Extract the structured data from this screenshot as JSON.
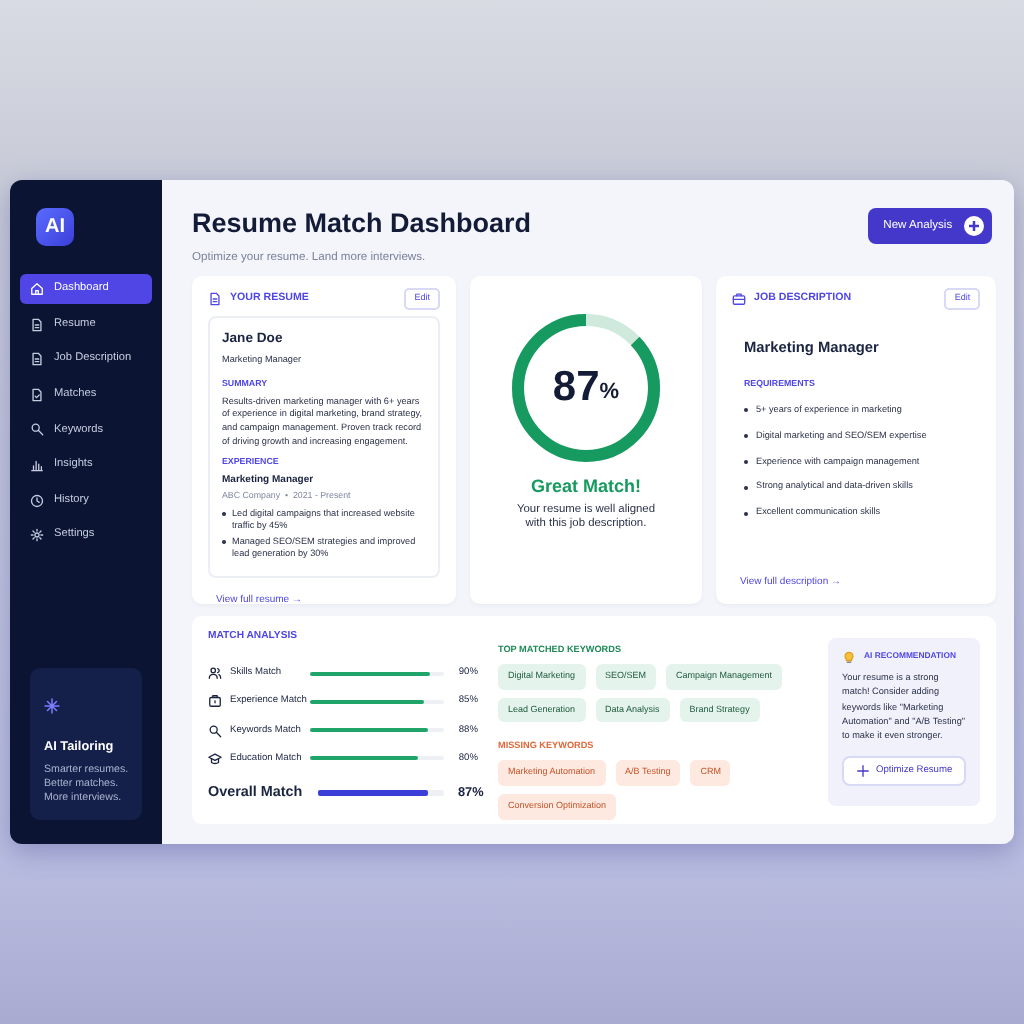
{
  "sidebar": {
    "logo": "AI",
    "items": [
      {
        "label": "Dashboard",
        "selected": true
      },
      {
        "label": "Resume",
        "selected": false
      },
      {
        "label": "Job Description",
        "selected": false
      },
      {
        "label": "Matches",
        "selected": false
      },
      {
        "label": "Keywords",
        "selected": false
      },
      {
        "label": "Insights",
        "selected": false
      },
      {
        "label": "History",
        "selected": false
      },
      {
        "label": "Settings",
        "selected": false
      }
    ],
    "promo": {
      "title": "AI Tailoring",
      "lines": [
        "Smarter resumes.",
        "Better matches.",
        "More interviews."
      ]
    }
  },
  "header": {
    "title": "Resume Match Dashboard",
    "subtitle": "Optimize your resume. Land more interviews.",
    "button": "New Analysis"
  },
  "resume": {
    "title": "YOUR RESUME",
    "edit": "Edit",
    "name": "Jane Doe",
    "role": "Marketing Manager",
    "summary_heading": "SUMMARY",
    "summary": "Results-driven marketing manager with 6+ years of experience in digital marketing, brand strategy, and campaign management. Proven track record of driving growth and increasing engagement.",
    "experience_heading": "EXPERIENCE",
    "job_title": "Marketing Manager",
    "company": "ABC Company  •  2021 - Present",
    "bullets": [
      "Led digital campaigns that increased website traffic by 45%",
      "Managed SEO/SEM strategies and improved lead generation by 30%"
    ],
    "link": "View full resume →"
  },
  "score": {
    "value": "87",
    "unit": "%",
    "level": 0.87,
    "verdict": "Great Match!",
    "message": "Your resume is well aligned with this job description."
  },
  "job": {
    "title": "JOB DESCRIPTION",
    "edit": "Edit",
    "role": "Marketing Manager",
    "requirements_heading": "REQUIREMENTS",
    "requirements": [
      "5+ years of experience in marketing",
      "Digital marketing and SEO/SEM expertise",
      "Experience with campaign management",
      "Strong analytical and data-driven skills",
      "Excellent communication skills"
    ],
    "link": "View full description →"
  },
  "analysis": {
    "title": "MATCH ANALYSIS",
    "rows": [
      {
        "kind": "item",
        "label": "Skills Match",
        "level": 0.9,
        "reading": "90%"
      },
      {
        "kind": "item",
        "label": "Experience Match",
        "level": 0.85,
        "reading": "85%"
      },
      {
        "kind": "item",
        "label": "Keywords Match",
        "level": 0.88,
        "reading": "88%"
      },
      {
        "kind": "item",
        "label": "Education Match",
        "level": 0.8,
        "reading": "80%"
      },
      {
        "kind": "overall",
        "label": "Overall Match",
        "level": 0.87,
        "reading": "87%"
      }
    ]
  },
  "keywords": {
    "matched_title": "TOP MATCHED KEYWORDS",
    "matched": [
      "Digital Marketing",
      "SEO/SEM",
      "Campaign Management",
      "Lead Generation",
      "Data Analysis",
      "Brand Strategy"
    ],
    "missing_title": "MISSING KEYWORDS",
    "missing": [
      "Marketing Automation",
      "A/B Testing",
      "CRM",
      "Conversion Optimization"
    ]
  },
  "recommendation": {
    "title": "AI RECOMMENDATION",
    "text": "Your resume is a strong match! Consider adding keywords like \"Marketing Automation\" and \"A/B Testing\" to make it even stronger.",
    "button": "Optimize Resume"
  }
}
